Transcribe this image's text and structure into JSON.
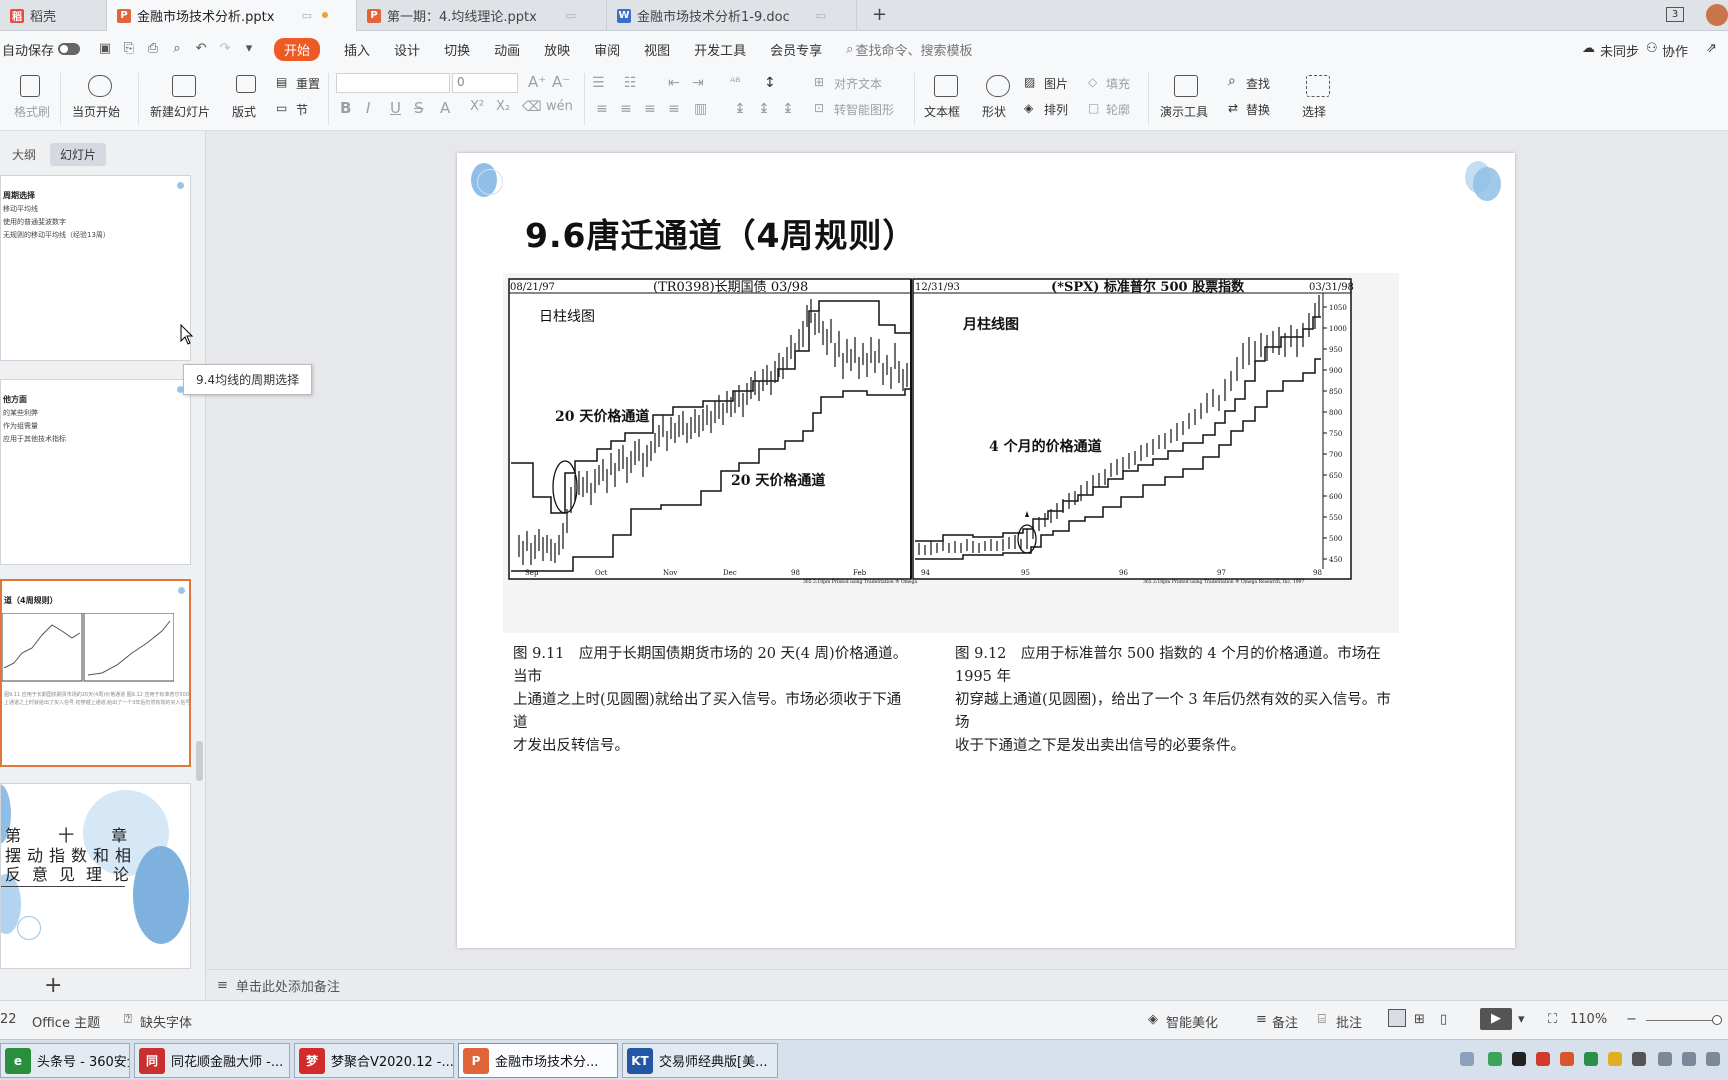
{
  "tabs": [
    {
      "label": "稻壳",
      "icon": "docer-icon",
      "color": "#e84c3d"
    },
    {
      "label": "金融市场技术分析.pptx",
      "icon": "ppt-icon",
      "color": "#e0663a",
      "active": true
    },
    {
      "label": "第一期：4.均线理论.pptx",
      "icon": "ppt-icon",
      "color": "#e0663a"
    },
    {
      "label": "金融市场技术分析1-9.doc",
      "icon": "word-icon",
      "color": "#3b6fc9"
    }
  ],
  "titlebar": {
    "new_tab": "+",
    "window_count": "3"
  },
  "menu": {
    "autosave": "自动保存",
    "items": [
      "开始",
      "插入",
      "设计",
      "切换",
      "动画",
      "放映",
      "审阅",
      "视图",
      "开发工具",
      "会员专享"
    ],
    "search": "查找命令、搜索模板",
    "sync": "未同步",
    "collab": "协作"
  },
  "ribbon": {
    "format_painter": "格式刷",
    "from_current": "当页开始",
    "new_slide": "新建幻灯片",
    "layout": "版式",
    "reset": "重置",
    "section": "节",
    "font_size": "0",
    "align_text": "对齐文本",
    "smartart": "转智能图形",
    "textbox": "文本框",
    "shape": "形状",
    "picture": "图片",
    "arrange": "排列",
    "fill": "填充",
    "outline": "轮廓",
    "present_tools": "演示工具",
    "find": "查找",
    "replace": "替换",
    "select": "选择"
  },
  "left_panel": {
    "tab_outline": "大纲",
    "tab_slides": "幻灯片",
    "slides": [
      {
        "title": "周期选择",
        "lines": [
          "移动平均线",
          "使用的普通斐波数字",
          "无规则的移动平均线（经验13周）"
        ]
      },
      {
        "title": "他方面",
        "lines": [
          "的某些利弊",
          "作为组需量",
          "应用于其他技术指标"
        ]
      },
      {
        "title": "道（4周规则）",
        "lines": []
      },
      {
        "title": "第 十 章",
        "lines": [
          "摆动指数和相",
          "反意见理论"
        ]
      }
    ],
    "add_button": "+",
    "tooltip": "9.4均线的周期选择"
  },
  "slide": {
    "title": "9.6唐迁通道（4周规则）",
    "caption_left": [
      "图 9.11　应用于长期国债期货市场的 20 天(4 周)价格通道。当市",
      "上通道之上时(见圆圈)就给出了买入信号。市场必须收于下通道",
      "才发出反转信号。"
    ],
    "caption_right": [
      "图 9.12　应用于标准普尔 500 指数的 4 个月的价格通道。市场在 1995 年",
      "初穿越上通道(见圆圈)，给出了一个 3 年后仍然有效的买入信号。市场",
      "收于下通道之下是发出卖出信号的必要条件。"
    ]
  },
  "chart_left": {
    "header_date": "08/21/97",
    "header_title": "(TR0398)长期国债 03/98",
    "label_daily": "日柱线图",
    "label_upper": "20 天价格通道",
    "label_lower": "20 天价格通道",
    "x_ticks": [
      "Sep",
      "Oct",
      "Nov",
      "Dec",
      "98",
      "Feb"
    ],
    "footer": "365 2:18pm Printed using TradeStation ® Omega"
  },
  "chart_right": {
    "header_date": "12/31/93",
    "header_title": "(*SPX) 标准普尔 500  股票指数",
    "header_date_right": "03/31/98",
    "label_monthly": "月柱线图",
    "label_channel": "4 个月的价格通道",
    "x_ticks": [
      "94",
      "95",
      "96",
      "97",
      "98"
    ],
    "y_ticks": [
      "1050",
      "1000",
      "950",
      "900",
      "850",
      "800",
      "750",
      "700",
      "650",
      "600",
      "550",
      "500",
      "450"
    ],
    "footer": "365 2:18pm Printed using TradeStation ® Omega Research, Inc. 1997"
  },
  "notes": {
    "placeholder": "单击此处添加备注"
  },
  "status": {
    "slide_num": "22",
    "theme": "Office 主题",
    "missing_font": "缺失字体",
    "beautify": "智能美化",
    "notes": "备注",
    "comments": "批注",
    "zoom": "110%"
  },
  "taskbar": [
    {
      "label": "头条号 - 360安全...",
      "color": "#2a8f3c",
      "icon": "e"
    },
    {
      "label": "同花顺金融大师 -...",
      "color": "#c8312f",
      "icon": "同"
    },
    {
      "label": "梦聚合V2020.12 -...",
      "color": "#d12b2b",
      "icon": "梦"
    },
    {
      "label": "金融市场技术分...",
      "color": "#e0663a",
      "icon": "P",
      "active": true
    },
    {
      "label": "交易师经典版[美...",
      "color": "#2456a6",
      "icon": "KT"
    }
  ],
  "colors": {
    "accent": "#ee5a24",
    "selected_border": "#e0763a"
  }
}
